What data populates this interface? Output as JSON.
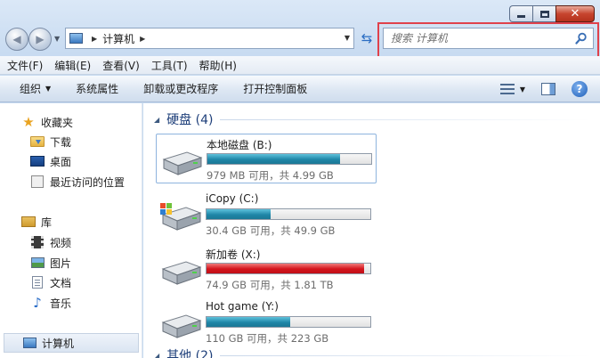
{
  "window": {
    "close_symbol": "✕"
  },
  "address": {
    "crumbs": [
      "计算机"
    ]
  },
  "search": {
    "placeholder": "搜索 计算机"
  },
  "menu": [
    "文件(F)",
    "编辑(E)",
    "查看(V)",
    "工具(T)",
    "帮助(H)"
  ],
  "toolbar": {
    "organize": "组织",
    "system_properties": "系统属性",
    "uninstall": "卸载或更改程序",
    "control_panel": "打开控制面板",
    "help": "?"
  },
  "nav": {
    "favorites": "收藏夹",
    "downloads": "下载",
    "desktop": "桌面",
    "recent": "最近访问的位置",
    "libraries": "库",
    "videos": "视频",
    "pictures": "图片",
    "documents": "文档",
    "music": "音乐",
    "computer": "计算机"
  },
  "groups": {
    "hard_disks": "硬盘 (4)",
    "other": "其他 (2)"
  },
  "drives": [
    {
      "name": "本地磁盘 (B:)",
      "stat": "979 MB 可用，共 4.99 GB",
      "used_fraction": 0.81,
      "color": "#1f86a8",
      "os": false
    },
    {
      "name": "iCopy (C:)",
      "stat": "30.4 GB 可用，共 49.9 GB",
      "used_fraction": 0.39,
      "color": "#1f86a8",
      "os": true
    },
    {
      "name": "新加卷 (X:)",
      "stat": "74.9 GB 可用，共 1.81 TB",
      "used_fraction": 0.96,
      "color": "#d4141c",
      "os": false
    },
    {
      "name": "Hot game (Y:)",
      "stat": "110 GB 可用，共 223 GB",
      "used_fraction": 0.51,
      "color": "#1f86a8",
      "os": false
    }
  ],
  "colors": {
    "highlight": "#e0414b",
    "header_text": "#1e3f7a"
  }
}
